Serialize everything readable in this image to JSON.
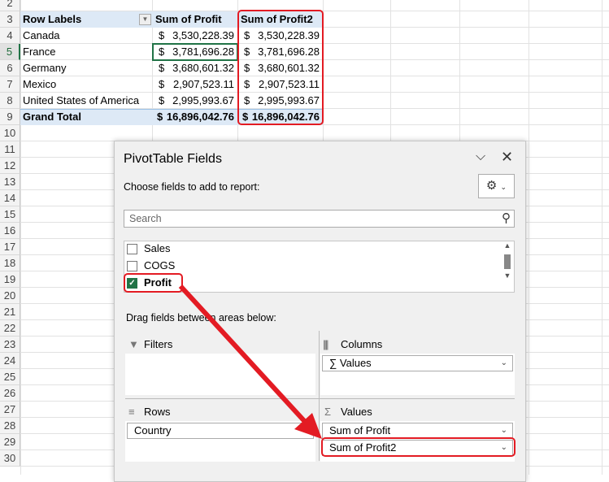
{
  "rows": [
    "2",
    "3",
    "4",
    "5",
    "6",
    "7",
    "8",
    "9",
    "10",
    "11",
    "12",
    "13",
    "14",
    "15",
    "16",
    "17",
    "18",
    "19",
    "20",
    "21",
    "22",
    "23",
    "24",
    "25",
    "26",
    "27",
    "28",
    "29",
    "30"
  ],
  "pivot": {
    "header": {
      "row_labels": "Row Labels",
      "col1": "Sum of Profit",
      "col2": "Sum of Profit2"
    },
    "data": [
      {
        "label": "Canada",
        "v1": "3,530,228.39",
        "v2": "3,530,228.39"
      },
      {
        "label": "France",
        "v1": "3,781,696.28",
        "v2": "3,781,696.28"
      },
      {
        "label": "Germany",
        "v1": "3,680,601.32",
        "v2": "3,680,601.32"
      },
      {
        "label": "Mexico",
        "v1": "2,907,523.11",
        "v2": "2,907,523.11"
      },
      {
        "label": "United States of America",
        "v1": "2,995,993.67",
        "v2": "2,995,993.67"
      }
    ],
    "currency": "$",
    "total": {
      "label": "Grand Total",
      "v1": "16,896,042.76",
      "v2": "16,896,042.76"
    }
  },
  "panel": {
    "title": "PivotTable Fields",
    "choose": "Choose fields to add to report:",
    "search_placeholder": "Search",
    "fields": [
      {
        "label": "Sales",
        "checked": false
      },
      {
        "label": "COGS",
        "checked": false
      },
      {
        "label": "Profit",
        "checked": true
      }
    ],
    "drag": "Drag fields between areas below:",
    "filters": "Filters",
    "columns": "Columns",
    "rows": "Rows",
    "values": "Values",
    "columns_items": [
      "Values"
    ],
    "rows_items": [
      "Country"
    ],
    "values_items": [
      "Sum of Profit",
      "Sum of Profit2"
    ]
  },
  "colors": {
    "accent": "#217346",
    "highlight": "#e31b23",
    "header_fill": "#dde9f6"
  }
}
